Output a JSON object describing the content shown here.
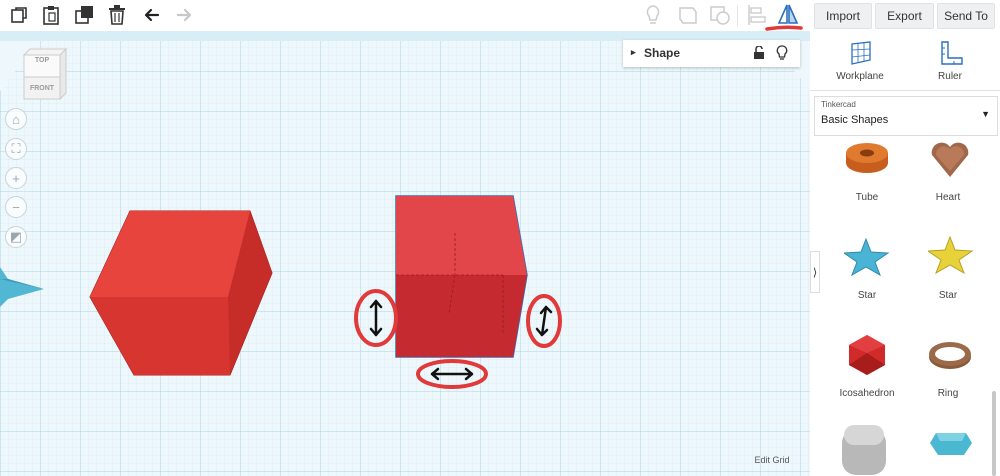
{
  "toolbar": {
    "left_icons": [
      "copy-icon",
      "paste-icon",
      "duplicate-icon",
      "delete-icon",
      "undo-icon",
      "redo-icon"
    ],
    "right_icons": [
      "bulb-icon",
      "group-icon",
      "ungroup-icon",
      "align-icon",
      "mirror-icon"
    ],
    "accent_color": "#2b6fbf",
    "highlight_color": "#e03a3a"
  },
  "header_buttons": {
    "import_label": "Import",
    "export_label": "Export",
    "send_to_label": "Send To"
  },
  "viewcube": {
    "top_label": "TOP",
    "front_label": "FRONT"
  },
  "nav_controls": [
    "home-icon",
    "fit-icon",
    "zoom-in-icon",
    "zoom-out-icon",
    "perspective-icon"
  ],
  "shape_panel": {
    "title": "Shape"
  },
  "right_panel": {
    "workplane_label": "Workplane",
    "ruler_label": "Ruler",
    "library_caption": "Tinkercad",
    "library_value": "Basic Shapes",
    "shapes": [
      {
        "label": "Tube",
        "color": "#e07a2e"
      },
      {
        "label": "Heart",
        "color": "#a0684a"
      },
      {
        "label": "Star",
        "color": "#4ab4d6"
      },
      {
        "label": "Star",
        "color": "#e8d23a"
      },
      {
        "label": "Icosahedron",
        "color": "#d02a2a"
      },
      {
        "label": "Ring",
        "color": "#9a6a4a"
      },
      {
        "label": "",
        "color": "#b8b8b8"
      },
      {
        "label": "",
        "color": "#4ab8d0"
      }
    ],
    "collapse_label": "⟩"
  },
  "canvas": {
    "edit_grid_label": "Edit Grid",
    "box_color": "#e03a34",
    "grid_color": "#bfe0ec"
  }
}
